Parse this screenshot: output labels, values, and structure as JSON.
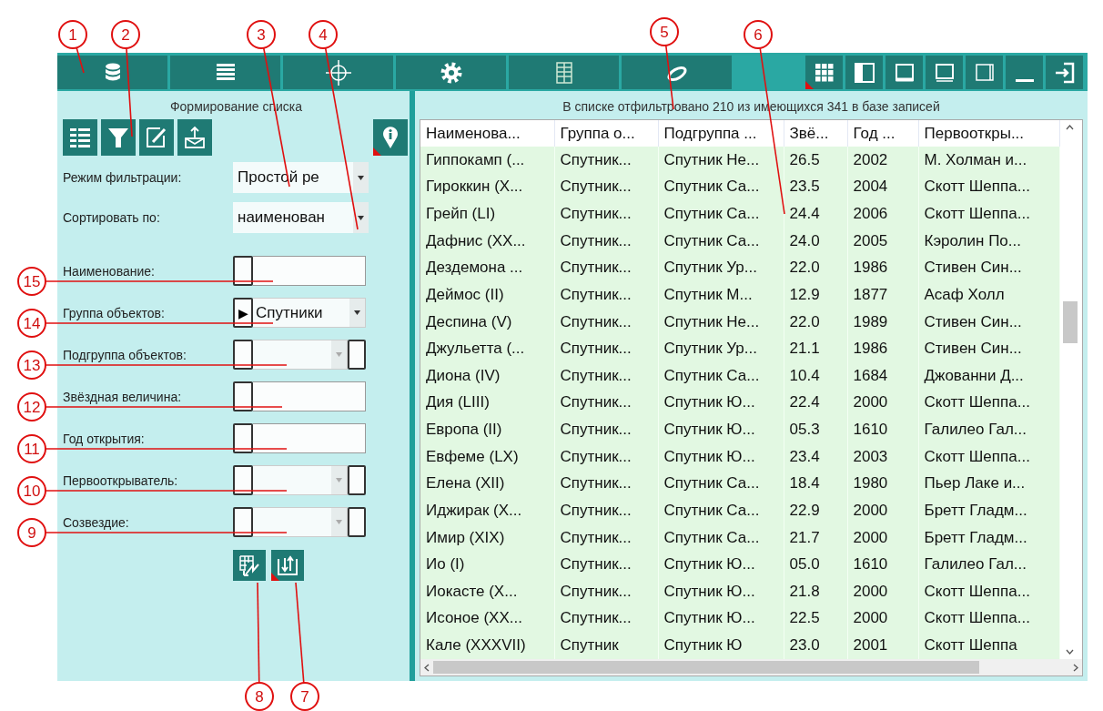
{
  "left_panel": {
    "title": "Формирование списка",
    "settings": [
      {
        "label": "Режим фильтрации:",
        "value": "Простой ре"
      },
      {
        "label": "Сортировать по:",
        "value": "наименован"
      }
    ],
    "filters": [
      {
        "label": "Наименование:",
        "kind": "text"
      },
      {
        "label": "Группа объектов:",
        "kind": "select",
        "toggle": "▶",
        "value": "Спутники"
      },
      {
        "label": "Подгруппа объектов:",
        "kind": "select-extra"
      },
      {
        "label": "Звёздная величина:",
        "kind": "text"
      },
      {
        "label": "Год открытия:",
        "kind": "text"
      },
      {
        "label": "Первооткрыватель:",
        "kind": "select-extra"
      },
      {
        "label": "Созвездие:",
        "kind": "select-extra"
      }
    ]
  },
  "right_panel": {
    "caption": "В списке отфильтровано 210 из имеющихся 341 в базе записей",
    "table": {
      "columns": [
        "Наименова...",
        "Группа о...",
        "Подгруппа ...",
        "Звё...",
        "Год ...",
        "Первооткры..."
      ],
      "rows": [
        [
          "Гиппокамп (...",
          "Спутник...",
          "Спутник Не...",
          "26.5",
          "2002",
          "М. Холман и..."
        ],
        [
          "Гироккин (Х...",
          "Спутник...",
          "Спутник Са...",
          "23.5",
          "2004",
          "Скотт Шеппа..."
        ],
        [
          "Грейп (LI)",
          "Спутник...",
          "Спутник Са...",
          "24.4",
          "2006",
          "Скотт Шеппа..."
        ],
        [
          "Дафнис (XX...",
          "Спутник...",
          "Спутник Са...",
          "24.0",
          "2005",
          "Кэролин По..."
        ],
        [
          "Дездемона ...",
          "Спутник...",
          "Спутник Ур...",
          "22.0",
          "1986",
          "Стивен Син..."
        ],
        [
          "Деймос (II)",
          "Спутник...",
          "Спутник М...",
          "12.9",
          "1877",
          "Асаф Холл"
        ],
        [
          "Деспина (V)",
          "Спутник...",
          "Спутник Не...",
          "22.0",
          "1989",
          "Стивен Син..."
        ],
        [
          "Джульетта (...",
          "Спутник...",
          "Спутник Ур...",
          "21.1",
          "1986",
          "Стивен Син..."
        ],
        [
          "Диона (IV)",
          "Спутник...",
          "Спутник Са...",
          "10.4",
          "1684",
          "Джованни Д..."
        ],
        [
          "Дия (LIII)",
          "Спутник...",
          "Спутник Ю...",
          "22.4",
          "2000",
          "Скотт Шеппа..."
        ],
        [
          "Европа (II)",
          "Спутник...",
          "Спутник Ю...",
          "05.3",
          "1610",
          "Галилео Гал..."
        ],
        [
          "Евфеме (LX)",
          "Спутник...",
          "Спутник Ю...",
          "23.4",
          "2003",
          "Скотт Шеппа..."
        ],
        [
          "Елена (XII)",
          "Спутник...",
          "Спутник Са...",
          "18.4",
          "1980",
          "Пьер Лаке и..."
        ],
        [
          "Иджирак (Х...",
          "Спутник...",
          "Спутник Са...",
          "22.9",
          "2000",
          "Бретт Гладм..."
        ],
        [
          "Имир (XIX)",
          "Спутник...",
          "Спутник Са...",
          "21.7",
          "2000",
          "Бретт Гладм..."
        ],
        [
          "Ио (I)",
          "Спутник...",
          "Спутник Ю...",
          "05.0",
          "1610",
          "Галилео Гал..."
        ],
        [
          "Иокасте (Х...",
          "Спутник...",
          "Спутник Ю...",
          "21.8",
          "2000",
          "Скотт Шеппа..."
        ],
        [
          "Исоное (XX...",
          "Спутник...",
          "Спутник Ю...",
          "22.5",
          "2000",
          "Скотт Шеппа..."
        ],
        [
          "Кале (XXXVII)",
          "Спутник",
          "Спутник Ю",
          "23.0",
          "2001",
          "Скотт Шеппа"
        ]
      ]
    }
  },
  "callouts": [
    {
      "label": "1"
    },
    {
      "label": "2"
    },
    {
      "label": "3"
    },
    {
      "label": "4"
    },
    {
      "label": "5"
    },
    {
      "label": "6"
    },
    {
      "label": "15"
    },
    {
      "label": "14"
    },
    {
      "label": "13"
    },
    {
      "label": "12"
    },
    {
      "label": "11"
    },
    {
      "label": "10"
    },
    {
      "label": "9"
    },
    {
      "label": "8"
    },
    {
      "label": "7"
    }
  ]
}
